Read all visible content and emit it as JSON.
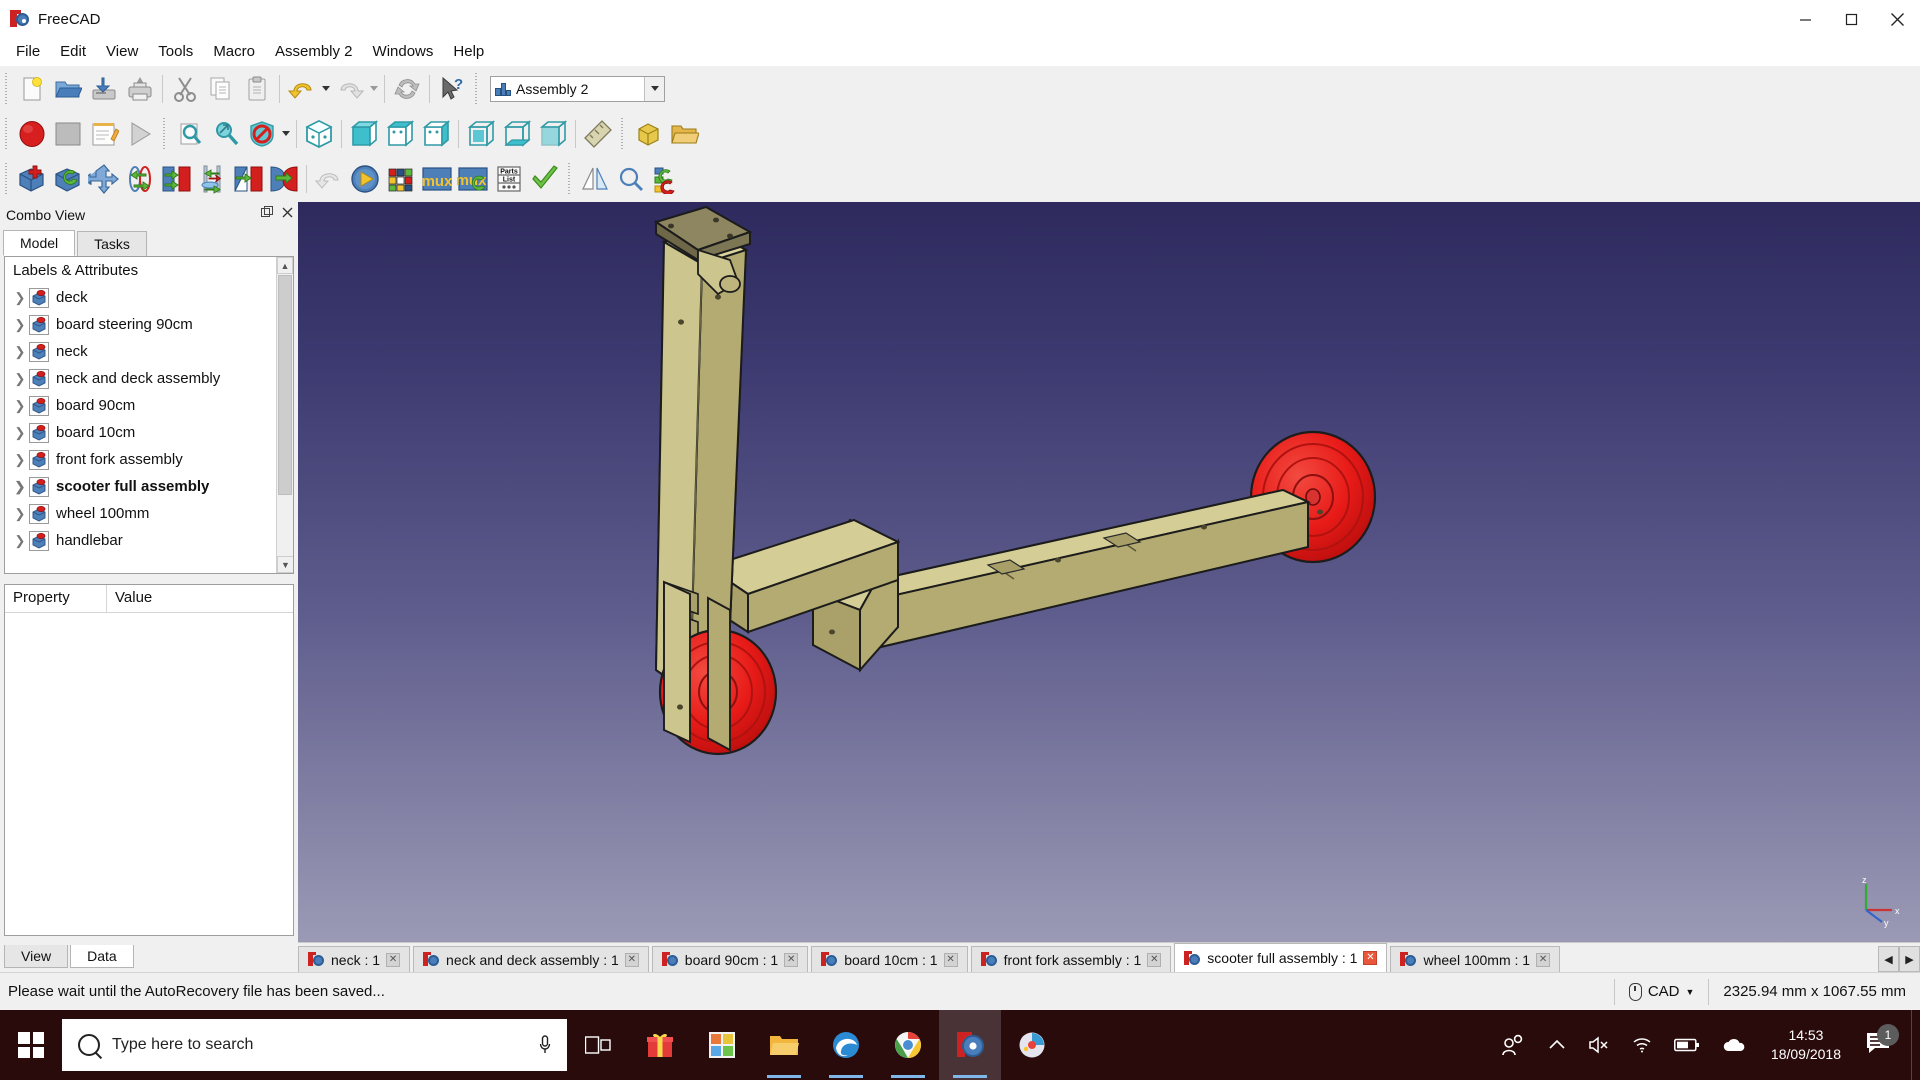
{
  "window": {
    "title": "FreeCAD",
    "minimize_label": "minimize",
    "maximize_label": "maximize",
    "close_label": "close"
  },
  "menubar": {
    "items": [
      {
        "label": "File"
      },
      {
        "label": "Edit"
      },
      {
        "label": "View"
      },
      {
        "label": "Tools"
      },
      {
        "label": "Macro"
      },
      {
        "label": "Assembly 2"
      },
      {
        "label": "Windows"
      },
      {
        "label": "Help"
      }
    ]
  },
  "workbench": {
    "selected": "Assembly 2",
    "icon": "workbench-icon"
  },
  "toolbars": {
    "file": [
      {
        "name": "new-document-button",
        "icon": "new-file-icon",
        "tooltip": "New"
      },
      {
        "name": "open-document-button",
        "icon": "open-folder-icon",
        "tooltip": "Open"
      },
      {
        "name": "save-document-button",
        "icon": "save-icon",
        "tooltip": "Save"
      },
      {
        "name": "print-document-button",
        "icon": "print-icon",
        "tooltip": "Print"
      }
    ],
    "edit": [
      {
        "name": "cut-button",
        "icon": "scissors-icon",
        "tooltip": "Cut"
      },
      {
        "name": "copy-button",
        "icon": "copy-icon",
        "tooltip": "Copy"
      },
      {
        "name": "paste-button",
        "icon": "clipboard-icon",
        "tooltip": "Paste"
      },
      {
        "name": "undo-button",
        "icon": "undo-arrow-icon",
        "tooltip": "Undo"
      },
      {
        "name": "redo-button",
        "icon": "redo-arrow-icon",
        "tooltip": "Redo"
      },
      {
        "name": "refresh-button",
        "icon": "refresh-icon",
        "tooltip": "Refresh"
      },
      {
        "name": "whats-this-button",
        "icon": "cursor-question-icon",
        "tooltip": "What's This?"
      }
    ],
    "macro": [
      {
        "name": "macro-record-button",
        "icon": "record-circle-icon",
        "tooltip": "Macro recording"
      },
      {
        "name": "macro-stop-button",
        "icon": "stop-square-icon",
        "tooltip": "Stop macro recording"
      },
      {
        "name": "macros-button",
        "icon": "notepad-pencil-icon",
        "tooltip": "Macros"
      },
      {
        "name": "execute-macro-button",
        "icon": "play-triangle-icon",
        "tooltip": "Execute macro"
      }
    ],
    "view": [
      {
        "name": "fit-all-button",
        "icon": "magnifier-page-icon",
        "tooltip": "Fit all"
      },
      {
        "name": "fit-selection-button",
        "icon": "magnifier-box-icon",
        "tooltip": "Fit selection"
      },
      {
        "name": "draw-style-button",
        "icon": "no-shield-icon",
        "tooltip": "Draw style"
      },
      {
        "name": "isometric-view-button",
        "icon": "cube-isometric-icon",
        "tooltip": "Isometric"
      },
      {
        "name": "front-view-button",
        "icon": "cube-front-icon",
        "tooltip": "Front"
      },
      {
        "name": "top-view-button",
        "icon": "cube-top-icon",
        "tooltip": "Top"
      },
      {
        "name": "right-view-button",
        "icon": "cube-right-icon",
        "tooltip": "Right"
      },
      {
        "name": "rear-view-button",
        "icon": "cube-rear-icon",
        "tooltip": "Rear"
      },
      {
        "name": "bottom-view-button",
        "icon": "cube-bottom-icon",
        "tooltip": "Bottom"
      },
      {
        "name": "left-view-button",
        "icon": "cube-left-icon",
        "tooltip": "Left"
      },
      {
        "name": "measure-button",
        "icon": "ruler-icon",
        "tooltip": "Measure"
      }
    ],
    "structure": [
      {
        "name": "create-part-button",
        "icon": "part-box-icon",
        "tooltip": "Create part"
      },
      {
        "name": "create-group-button",
        "icon": "folder-group-icon",
        "tooltip": "Create group"
      }
    ],
    "assembly": [
      {
        "name": "import-part-button",
        "icon": "cube-plus-icon",
        "tooltip": "Import a part from another FreeCAD document"
      },
      {
        "name": "update-parts-button",
        "icon": "cube-refresh-icon",
        "tooltip": "Update imported parts"
      },
      {
        "name": "move-part-button",
        "icon": "move-arrows-icon",
        "tooltip": "Move part"
      },
      {
        "name": "axial-constraint-button",
        "icon": "axial-constraint-icon",
        "tooltip": "Add circular axis constraint"
      },
      {
        "name": "plane-constraint-button",
        "icon": "plane-constraint-icon",
        "tooltip": "Add plane constraint"
      },
      {
        "name": "angle-constraint-button",
        "icon": "angle-constraint-icon",
        "tooltip": "Add angle constraint"
      },
      {
        "name": "spherical-constraint-button",
        "icon": "spherical-constraint-icon",
        "tooltip": "Add spherical constraint"
      },
      {
        "name": "circular-edge-constraint-button",
        "icon": "circular-edge-constraint-icon",
        "tooltip": "Add circular edge constraint"
      },
      {
        "name": "undo-constraint-button",
        "icon": "undo-grey-icon",
        "tooltip": "Undo"
      },
      {
        "name": "solve-constraints-button",
        "icon": "play-blue-icon",
        "tooltip": "Solve constraints"
      },
      {
        "name": "mux-assembly-button",
        "icon": "rubik-cube-icon",
        "tooltip": "Muxed assembly"
      },
      {
        "name": "create-mux-button",
        "icon": "mux-icon",
        "tooltip": "Create muxed assembly"
      },
      {
        "name": "update-mux-button",
        "icon": "mux-refresh-icon",
        "tooltip": "Update muxed assembly"
      },
      {
        "name": "parts-list-button",
        "icon": "parts-list-icon",
        "tooltip": "Parts list"
      },
      {
        "name": "check-button",
        "icon": "green-check-icon",
        "tooltip": "Check assembly"
      }
    ],
    "extra": [
      {
        "name": "mirror-button",
        "icon": "mirror-icon",
        "tooltip": "Mirror"
      },
      {
        "name": "shape-info-button",
        "icon": "magnifier-shape-icon",
        "tooltip": "Shape info"
      },
      {
        "name": "tree-tools-button",
        "icon": "tree-tools-icon",
        "tooltip": "Tree tools"
      }
    ]
  },
  "combo_view": {
    "title": "Combo View",
    "float_label": "float panel",
    "close_label": "close panel",
    "tabs": [
      {
        "label": "Model",
        "active": true
      },
      {
        "label": "Tasks",
        "active": false
      }
    ],
    "tree_header": "Labels & Attributes",
    "tree_items": [
      {
        "label": "deck",
        "bold": false
      },
      {
        "label": "board steering 90cm",
        "bold": false
      },
      {
        "label": "neck",
        "bold": false
      },
      {
        "label": "neck and deck assembly",
        "bold": false
      },
      {
        "label": "board 90cm",
        "bold": false
      },
      {
        "label": "board 10cm",
        "bold": false
      },
      {
        "label": "front fork assembly",
        "bold": false
      },
      {
        "label": "scooter full assembly",
        "bold": true
      },
      {
        "label": "wheel 100mm",
        "bold": false
      },
      {
        "label": "handlebar",
        "bold": false
      }
    ],
    "property_columns": [
      "Property",
      "Value"
    ],
    "property_rows": [],
    "bottom_tabs": [
      {
        "label": "View",
        "active": false
      },
      {
        "label": "Data",
        "active": true
      }
    ]
  },
  "document_tabs": [
    {
      "label": "neck : 1",
      "active": false
    },
    {
      "label": "neck and deck assembly : 1",
      "active": false
    },
    {
      "label": "board 90cm : 1",
      "active": false
    },
    {
      "label": "board 10cm : 1",
      "active": false
    },
    {
      "label": "front fork assembly : 1",
      "active": false
    },
    {
      "label": "scooter full assembly : 1",
      "active": true
    },
    {
      "label": "wheel 100mm : 1",
      "active": false
    }
  ],
  "tab_nav": {
    "prev": "◀",
    "next": "▶"
  },
  "statusbar": {
    "message": "Please wait until the AutoRecovery file has been saved...",
    "nav_style": "CAD",
    "dimensions": "2325.94 mm x 1067.55 mm"
  },
  "taskbar": {
    "search_placeholder": "Type here to search",
    "apps": [
      {
        "name": "task-view-button",
        "icon": "task-view-icon"
      },
      {
        "name": "gift-app-button",
        "icon": "gift-icon"
      },
      {
        "name": "store-app-button",
        "icon": "store-icon"
      },
      {
        "name": "file-explorer-button",
        "icon": "folder-icon"
      },
      {
        "name": "edge-browser-button",
        "icon": "edge-icon"
      },
      {
        "name": "chrome-browser-button",
        "icon": "chrome-icon"
      },
      {
        "name": "freecad-app-button",
        "icon": "freecad-icon"
      },
      {
        "name": "paint3d-app-button",
        "icon": "paint3d-icon"
      }
    ],
    "tray": [
      {
        "name": "people-tray-icon",
        "icon": "people-icon"
      },
      {
        "name": "show-hidden-icons-button",
        "icon": "chevron-up-icon"
      },
      {
        "name": "volume-tray-icon",
        "icon": "speaker-muted-icon"
      },
      {
        "name": "network-tray-icon",
        "icon": "wifi-icon"
      },
      {
        "name": "battery-tray-icon",
        "icon": "battery-icon"
      },
      {
        "name": "onedrive-tray-icon",
        "icon": "cloud-icon"
      }
    ],
    "clock_time": "14:53",
    "clock_date": "18/09/2018",
    "notification_count": "1"
  },
  "viewport": {
    "model_name": "scooter full assembly",
    "background_top": "#2e2a5e",
    "background_bottom": "#9b9ab5",
    "wood_color": "#c8c188",
    "wood_shade": "#a8a06a",
    "wheel_color": "#e81b18",
    "axis_labels": {
      "x": "x",
      "y": "y",
      "z": "z"
    }
  }
}
